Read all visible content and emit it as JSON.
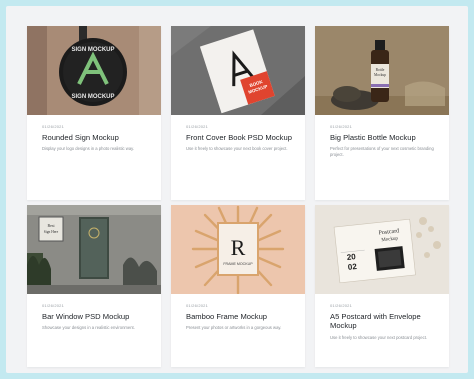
{
  "cards": [
    {
      "date": "01/26/2021",
      "title": "Rounded Sign Mockup",
      "desc": "Display your logo designs in a photo realistic way.",
      "thumb_text": {
        "line1": "SIGN MOCKUP",
        "line2": "SIGN MOCKUP"
      }
    },
    {
      "date": "01/26/2021",
      "title": "Front Cover Book PSD Mockup",
      "desc": "Use it freely to showcase your next book cover project.",
      "thumb_text": {
        "line1": "BOOK",
        "line2": "MOCKUP"
      }
    },
    {
      "date": "01/26/2021",
      "title": "Big Plastic Bottle Mockup",
      "desc": "Perfect for presentations of your next cosmetic branding project.",
      "thumb_text": {
        "line1": "Bottle",
        "line2": "Mockup"
      }
    },
    {
      "date": "01/26/2021",
      "title": "Bar Window PSD Mockup",
      "desc": "Showcase your designs in a realistic environment.",
      "thumb_text": {
        "line1": "Best",
        "line2": "Sign Here"
      }
    },
    {
      "date": "01/26/2021",
      "title": "Bamboo Frame Mockup",
      "desc": "Present your photos or artworks in a gorgeous way.",
      "thumb_text": {
        "line1": "R",
        "line2": "FRAME MOCKUP"
      }
    },
    {
      "date": "01/26/2021",
      "title": "A5 Postcard with Envelope Mockup",
      "desc": "Use it freely to showcase your next postcard project.",
      "thumb_text": {
        "line1": "Postcard",
        "line2": "Mockup",
        "line3": "20",
        "line4": "02"
      }
    }
  ]
}
